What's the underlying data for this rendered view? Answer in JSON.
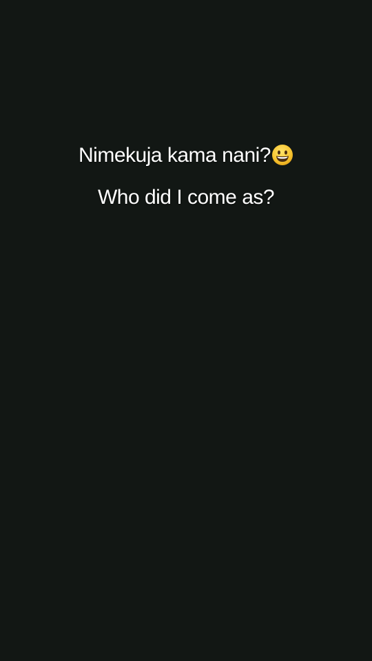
{
  "colors": {
    "background": "#121714",
    "text": "#ffffff",
    "emoji_face": "#f7c531",
    "emoji_face_shade": "#e7a91c",
    "emoji_features": "#4a2d0f"
  },
  "caption": {
    "line1": {
      "text": "Nimekuja kama nani?",
      "emoji_icon": "grinning-face-icon"
    },
    "line2": {
      "text": "Who did I come as?"
    }
  }
}
